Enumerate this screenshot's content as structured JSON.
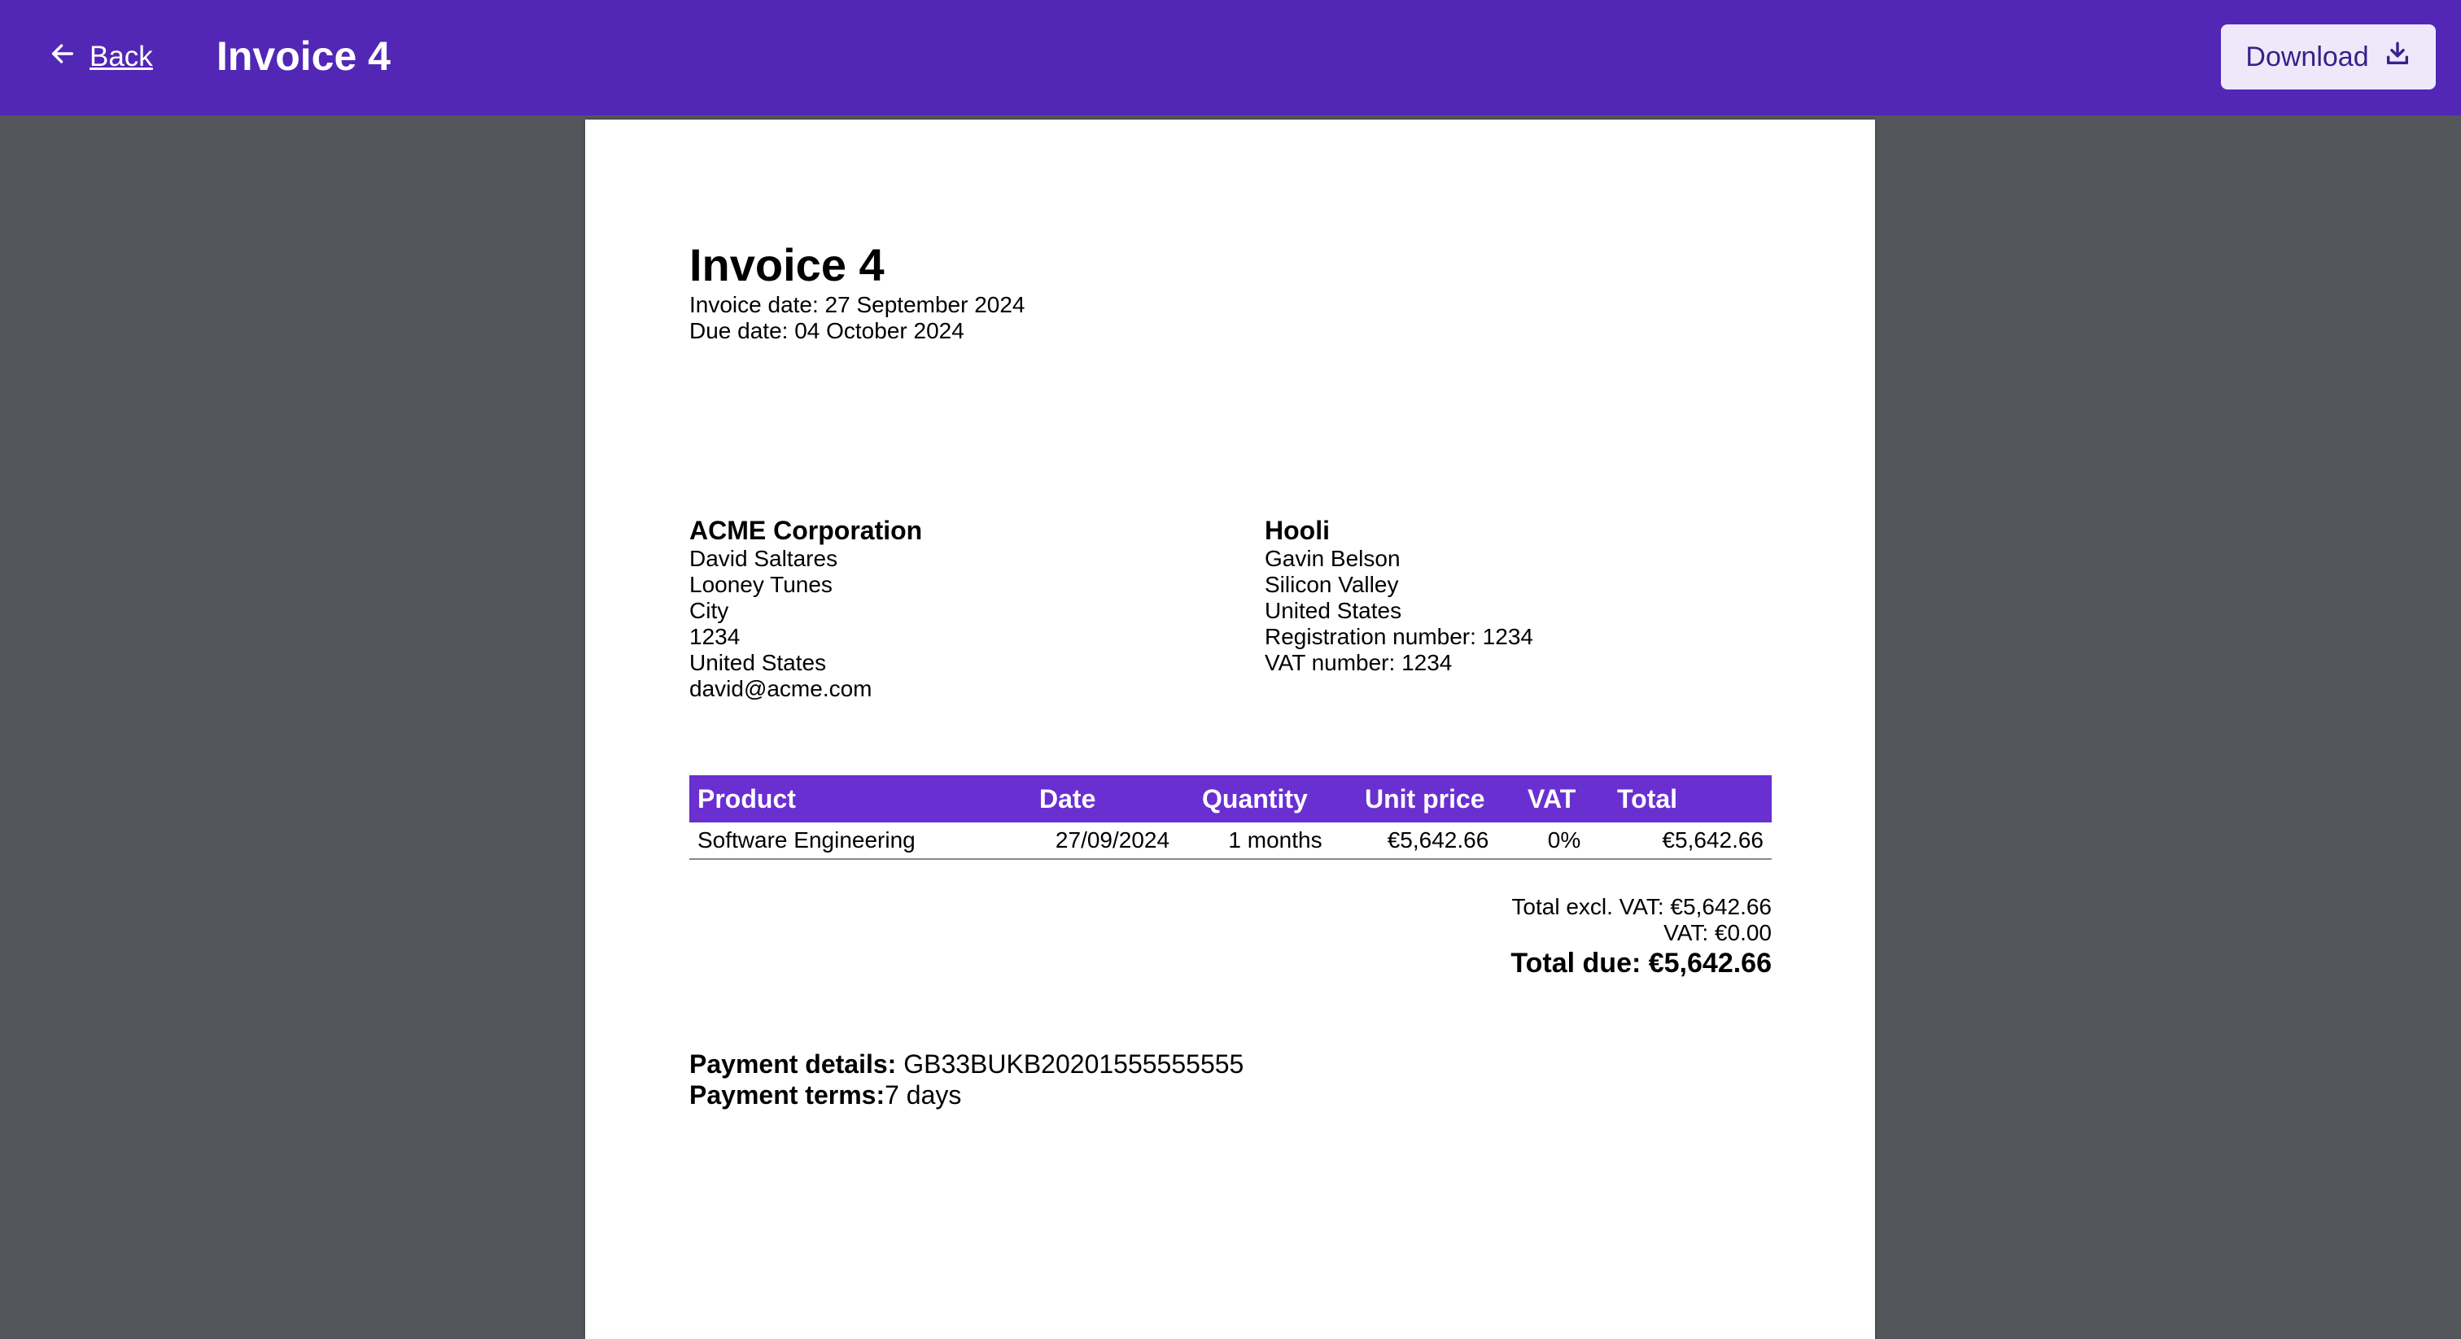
{
  "header": {
    "back_label": "Back",
    "title": "Invoice 4",
    "download_label": "Download"
  },
  "invoice": {
    "title": "Invoice 4",
    "invoice_date": "Invoice date: 27 September 2024",
    "due_date": "Due date: 04 October 2024",
    "seller": {
      "name": "ACME Corporation",
      "lines": [
        "David Saltares",
        "Looney Tunes",
        "City",
        "1234",
        "United States",
        "david@acme.com"
      ]
    },
    "buyer": {
      "name": "Hooli",
      "lines": [
        "Gavin Belson",
        "Silicon Valley",
        "United States",
        "Registration number: 1234",
        "VAT number: 1234"
      ]
    },
    "table": {
      "headers": [
        "Product",
        "Date",
        "Quantity",
        "Unit price",
        "VAT",
        "Total"
      ],
      "rows": [
        [
          "Software Engineering",
          "27/09/2024",
          "1 months",
          "€5,642.66",
          "0%",
          "€5,642.66"
        ]
      ]
    },
    "totals": {
      "excl_vat": "Total excl. VAT: €5,642.66",
      "vat": "VAT: €0.00",
      "due": "Total due: €5,642.66"
    },
    "payment": {
      "details_label": "Payment details:",
      "details_value": " GB33BUKB20201555555555",
      "terms_label": "Payment terms:",
      "terms_value": "7 days"
    }
  }
}
